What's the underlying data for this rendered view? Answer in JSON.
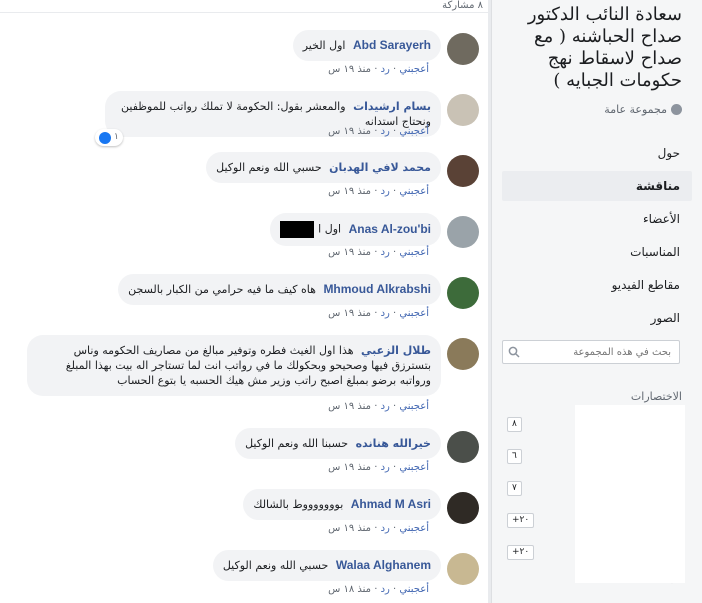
{
  "sidebar": {
    "group_title": "سعادة النائب الدكتور صداح الحباشنه ( مع صداح لاسقاط نهج حكومات الجبايه )",
    "group_type": "مجموعة عامة",
    "nav": [
      {
        "label": "حول"
      },
      {
        "label": "مناقشة"
      },
      {
        "label": "الأعضاء"
      },
      {
        "label": "المناسبات"
      },
      {
        "label": "مقاطع الفيديو"
      },
      {
        "label": "الصور"
      }
    ],
    "search_placeholder": "بحث في هذه المجموعة",
    "shortcuts_title": "الاختصارات",
    "shortcuts": [
      {
        "count": "٨"
      },
      {
        "count": "٦"
      },
      {
        "count": "٧"
      },
      {
        "count": "+٢٠"
      },
      {
        "count": "+٢٠"
      }
    ]
  },
  "feed": {
    "share_count": "٨ مشاركة",
    "actions": {
      "like": "أعجبني",
      "reply": "رد"
    },
    "comments": [
      {
        "author": "Abd Sarayerh",
        "text": "اول الخير",
        "time": "منذ ١٩ س"
      },
      {
        "author": "بسام ارشيدات",
        "text": "والمعشر بقول: الحكومة لا تملك رواتب للموظفين ونحتاج استدانه",
        "time": "منذ ١٩ س",
        "likes": "١"
      },
      {
        "author": "محمد لافي الهدبان",
        "text": "حسبي الله ونعم الوكيل",
        "time": "منذ ١٩ س"
      },
      {
        "author": "Anas Al-zou'bi",
        "text": "اول ا",
        "time": "منذ ١٩ س"
      },
      {
        "author": "Mhmoud Alkrabshi",
        "text": "هاه كيف ما فيه حرامي من الكبار بالسجن",
        "time": "منذ ١٩ س"
      },
      {
        "author": "طلال الزعبي",
        "text": "هذا اول الغيث فطره وتوفير مبالغ من مصاريف الحكومه وناس بتسترزق فيها وصحيحو وبحكولك ما في رواتب انت لما تستاجر اله بيت بهذا المبلغ ورواتبه برضو بمبلغ اصبح راتب وزير مش هيك الحسبه يا بتوع الحساب",
        "time": "منذ ١٩ س"
      },
      {
        "author": "خيرالله هنانده",
        "text": "حسبنا الله ونعم الوكيل",
        "time": "منذ ١٩ س"
      },
      {
        "author": "Ahmad M Asri",
        "text": "بوووووووط بالشالك",
        "time": "منذ ١٩ س"
      },
      {
        "author": "Walaa Alghanem",
        "text": "حسبي الله ونعم الوكيل",
        "time": "منذ ١٨ س"
      }
    ]
  },
  "colors": {
    "link": "#385898",
    "bubble": "#f2f3f5",
    "sidebar_bg": "#f5f6f7",
    "action": "#4267b2"
  }
}
